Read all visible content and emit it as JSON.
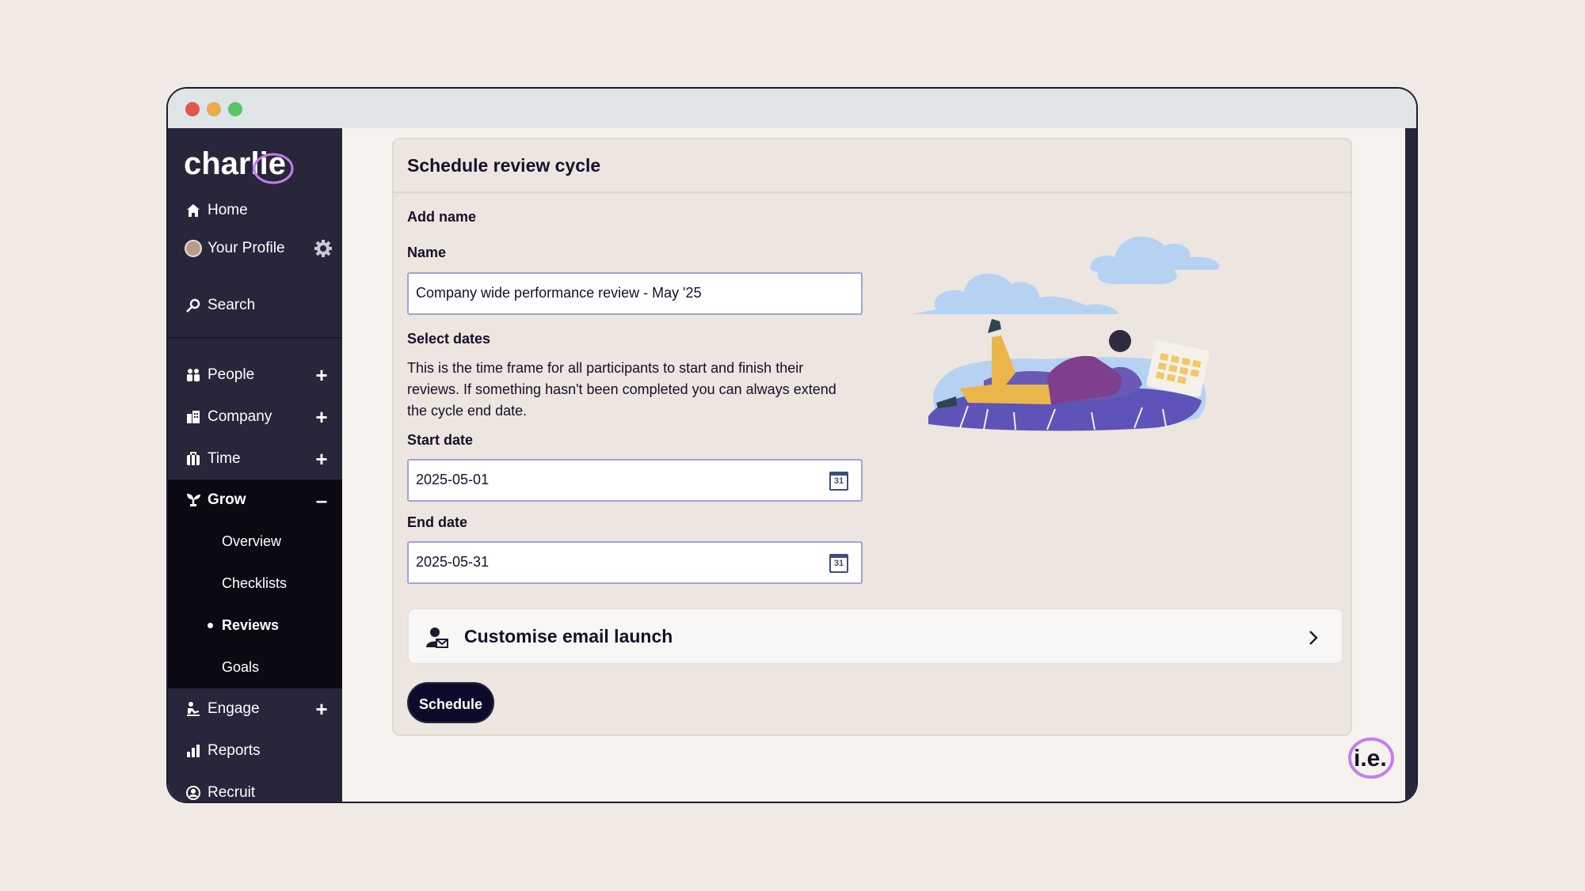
{
  "app": {
    "logo_text": "charlie",
    "corner_badge": "i.e."
  },
  "sidebar": {
    "items": [
      {
        "label": "Home",
        "icon": "home-icon"
      },
      {
        "label": "Your Profile",
        "icon": "avatar"
      },
      {
        "label": "Search",
        "icon": "search-icon"
      },
      {
        "label": "People",
        "icon": "people-icon",
        "toggle": "+"
      },
      {
        "label": "Company",
        "icon": "company-icon",
        "toggle": "+"
      },
      {
        "label": "Time",
        "icon": "time-icon",
        "toggle": "+"
      },
      {
        "label": "Grow",
        "icon": "grow-icon",
        "toggle": "–"
      },
      {
        "label": "Engage",
        "icon": "engage-icon",
        "toggle": "+"
      },
      {
        "label": "Reports",
        "icon": "reports-icon"
      },
      {
        "label": "Recruit",
        "icon": "recruit-icon"
      }
    ],
    "grow_sub": [
      {
        "label": "Overview"
      },
      {
        "label": "Checklists"
      },
      {
        "label": "Reviews"
      },
      {
        "label": "Goals"
      }
    ]
  },
  "form": {
    "title": "Schedule review cycle",
    "add_name_heading": "Add name",
    "name_label": "Name",
    "name_value": "Company wide performance review - May '25",
    "select_dates_heading": "Select dates",
    "dates_description": "This is the time frame for all participants to start and finish their reviews. If something hasn't been completed you can always extend the cycle end date.",
    "start_label": "Start date",
    "start_value": "2025-05-01",
    "end_label": "End date",
    "end_value": "2025-05-31",
    "calendar_day": "31",
    "email_launch_label": "Customise email launch",
    "schedule_button": "Schedule"
  },
  "colors": {
    "sidebar_bg": "#27263a",
    "sidebar_active_bg": "#0b0a13",
    "button_bg": "#0d0b2c",
    "accent_purple": "#c77bf0",
    "input_border": "#9ea5d8"
  }
}
